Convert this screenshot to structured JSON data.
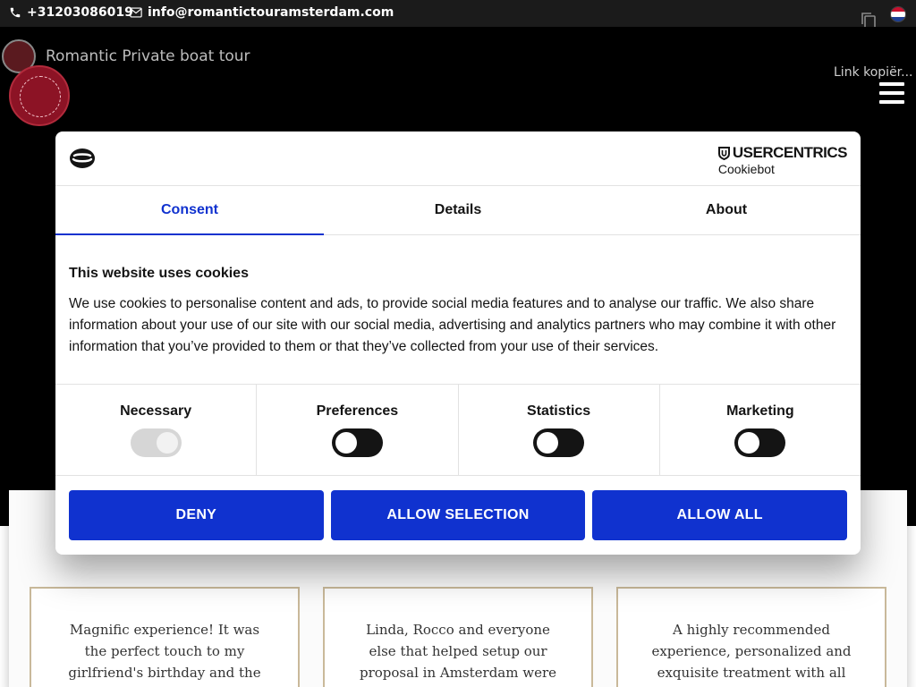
{
  "topbar": {
    "phone": "+31203086019",
    "email": "info@romantictouramsterdam.com"
  },
  "hero": {
    "video_title": "Romantic Private boat tour",
    "link_copy_label": "Link kopiër..."
  },
  "cookie_dialog": {
    "brand_name": "USERCENTRICS",
    "brand_sub": "Cookiebot",
    "tabs": [
      {
        "label": "Consent",
        "active": true
      },
      {
        "label": "Details",
        "active": false
      },
      {
        "label": "About",
        "active": false
      }
    ],
    "heading": "This website uses cookies",
    "text": "We use cookies to personalise content and ads, to provide social media features and to analyse our traffic. We also share information about your use of our site with our social media, advertising and analytics partners who may combine it with other information that you’ve provided to them or that they’ve collected from your use of their services.",
    "toggles": [
      {
        "label": "Necessary",
        "checked": true,
        "disabled": true
      },
      {
        "label": "Preferences",
        "checked": false,
        "disabled": false
      },
      {
        "label": "Statistics",
        "checked": false,
        "disabled": false
      },
      {
        "label": "Marketing",
        "checked": false,
        "disabled": false
      }
    ],
    "buttons": {
      "deny": "DENY",
      "allow_selection": "ALLOW SELECTION",
      "allow_all": "ALLOW ALL"
    },
    "accent_color": "#1032cf"
  },
  "reviews": [
    {
      "text": "Magnific experience! It was the perfect touch to my girlfriend's birthday and the stories told"
    },
    {
      "text": "Linda, Rocco and everyone else that helped setup our proposal in Amsterdam were nothing short of"
    },
    {
      "text": "A highly recommended experience, personalized and exquisite treatment with all kinds"
    }
  ]
}
